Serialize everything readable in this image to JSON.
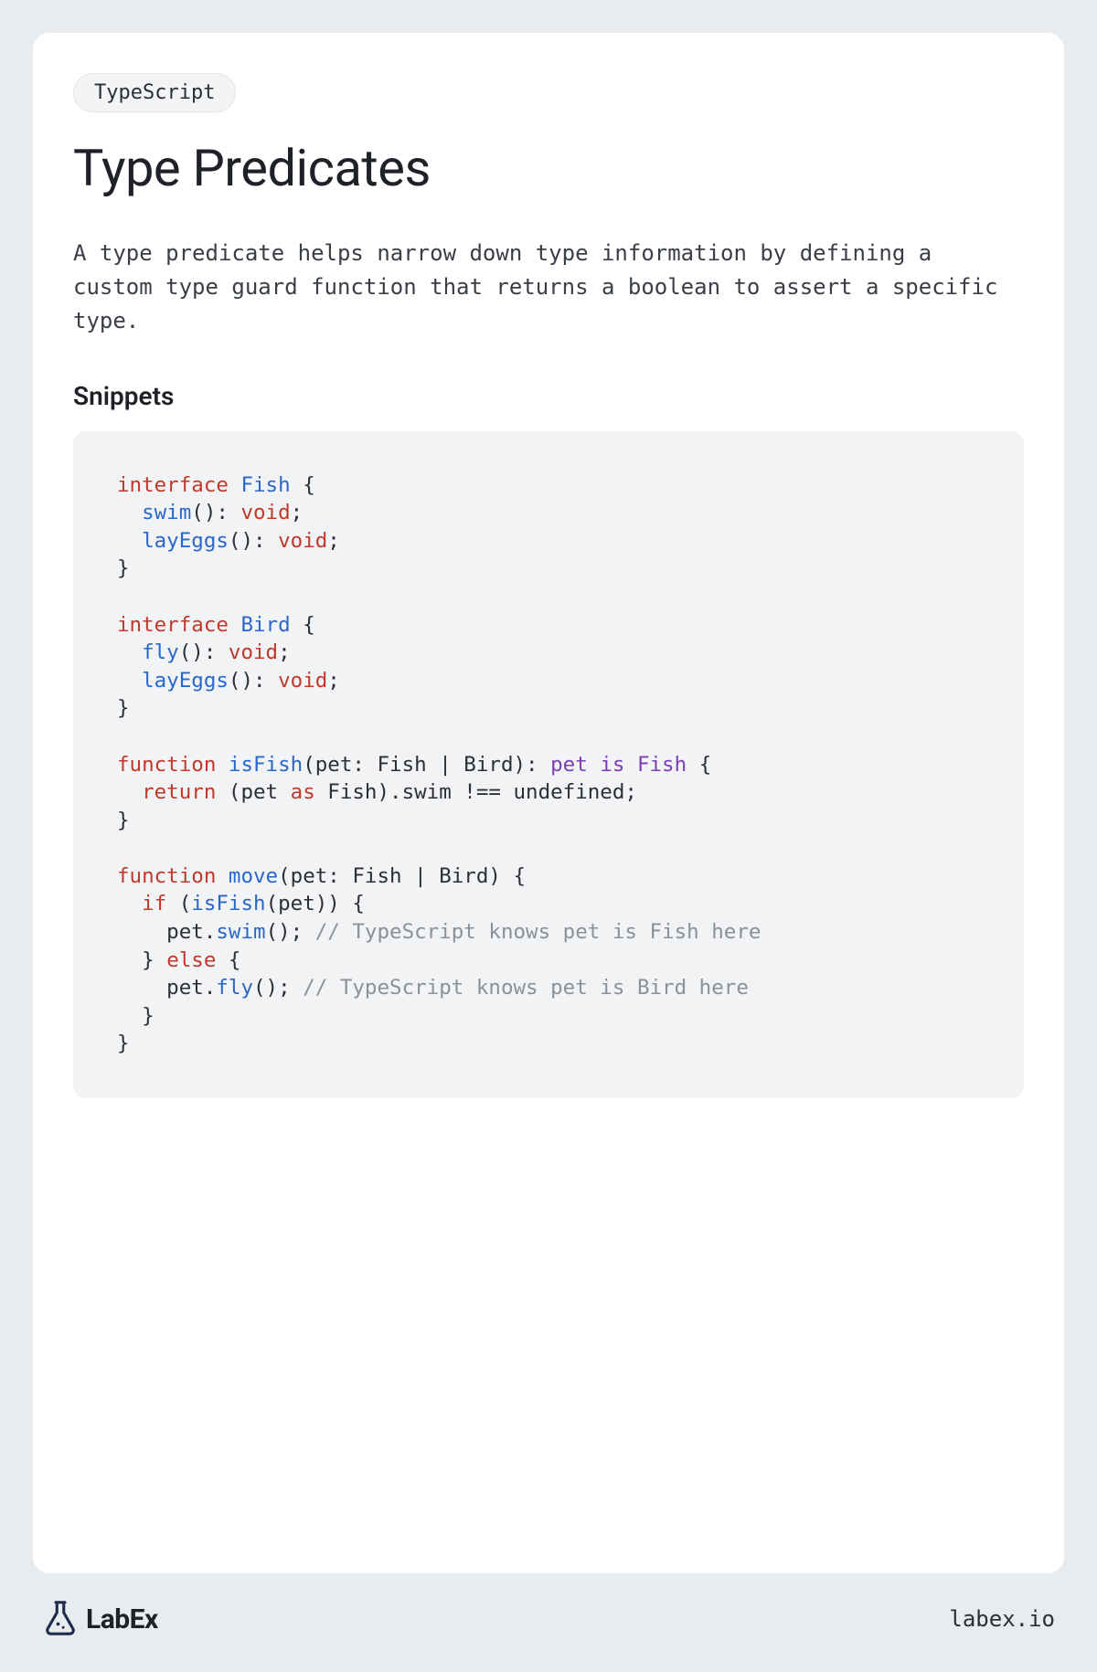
{
  "tag": "TypeScript",
  "title": "Type Predicates",
  "description": "A type predicate helps narrow down type information by defining a custom type guard function that returns a boolean to assert a specific type.",
  "section_heading": "Snippets",
  "code": {
    "lines": [
      [
        {
          "t": "interface ",
          "c": "kw"
        },
        {
          "t": "Fish",
          "c": "name"
        },
        {
          "t": " {",
          "c": ""
        }
      ],
      [
        {
          "t": "  ",
          "c": ""
        },
        {
          "t": "swim",
          "c": "name"
        },
        {
          "t": "(): ",
          "c": ""
        },
        {
          "t": "void",
          "c": "void"
        },
        {
          "t": ";",
          "c": ""
        }
      ],
      [
        {
          "t": "  ",
          "c": ""
        },
        {
          "t": "layEggs",
          "c": "name"
        },
        {
          "t": "(): ",
          "c": ""
        },
        {
          "t": "void",
          "c": "void"
        },
        {
          "t": ";",
          "c": ""
        }
      ],
      [
        {
          "t": "}",
          "c": ""
        }
      ],
      [],
      [
        {
          "t": "interface ",
          "c": "kw"
        },
        {
          "t": "Bird",
          "c": "name"
        },
        {
          "t": " {",
          "c": ""
        }
      ],
      [
        {
          "t": "  ",
          "c": ""
        },
        {
          "t": "fly",
          "c": "name"
        },
        {
          "t": "(): ",
          "c": ""
        },
        {
          "t": "void",
          "c": "void"
        },
        {
          "t": ";",
          "c": ""
        }
      ],
      [
        {
          "t": "  ",
          "c": ""
        },
        {
          "t": "layEggs",
          "c": "name"
        },
        {
          "t": "(): ",
          "c": ""
        },
        {
          "t": "void",
          "c": "void"
        },
        {
          "t": ";",
          "c": ""
        }
      ],
      [
        {
          "t": "}",
          "c": ""
        }
      ],
      [],
      [
        {
          "t": "function ",
          "c": "kw"
        },
        {
          "t": "isFish",
          "c": "name"
        },
        {
          "t": "(pet: Fish | Bird): ",
          "c": ""
        },
        {
          "t": "pet is Fish",
          "c": "type"
        },
        {
          "t": " {",
          "c": ""
        }
      ],
      [
        {
          "t": "  ",
          "c": ""
        },
        {
          "t": "return",
          "c": "kw"
        },
        {
          "t": " (pet ",
          "c": ""
        },
        {
          "t": "as",
          "c": "kw"
        },
        {
          "t": " Fish).swim !== undefined;",
          "c": ""
        }
      ],
      [
        {
          "t": "}",
          "c": ""
        }
      ],
      [],
      [
        {
          "t": "function ",
          "c": "kw"
        },
        {
          "t": "move",
          "c": "name"
        },
        {
          "t": "(pet: Fish | Bird) {",
          "c": ""
        }
      ],
      [
        {
          "t": "  ",
          "c": ""
        },
        {
          "t": "if",
          "c": "kw"
        },
        {
          "t": " (",
          "c": ""
        },
        {
          "t": "isFish",
          "c": "name"
        },
        {
          "t": "(pet)) {",
          "c": ""
        }
      ],
      [
        {
          "t": "    pet.",
          "c": ""
        },
        {
          "t": "swim",
          "c": "name"
        },
        {
          "t": "(); ",
          "c": ""
        },
        {
          "t": "// TypeScript knows pet is Fish here",
          "c": "cmt"
        }
      ],
      [
        {
          "t": "  } ",
          "c": ""
        },
        {
          "t": "else",
          "c": "kw"
        },
        {
          "t": " {",
          "c": ""
        }
      ],
      [
        {
          "t": "    pet.",
          "c": ""
        },
        {
          "t": "fly",
          "c": "name"
        },
        {
          "t": "(); ",
          "c": ""
        },
        {
          "t": "// TypeScript knows pet is Bird here",
          "c": "cmt"
        }
      ],
      [
        {
          "t": "  }",
          "c": ""
        }
      ],
      [
        {
          "t": "}",
          "c": ""
        }
      ]
    ]
  },
  "footer": {
    "brand": "LabEx",
    "site": "labex.io"
  }
}
